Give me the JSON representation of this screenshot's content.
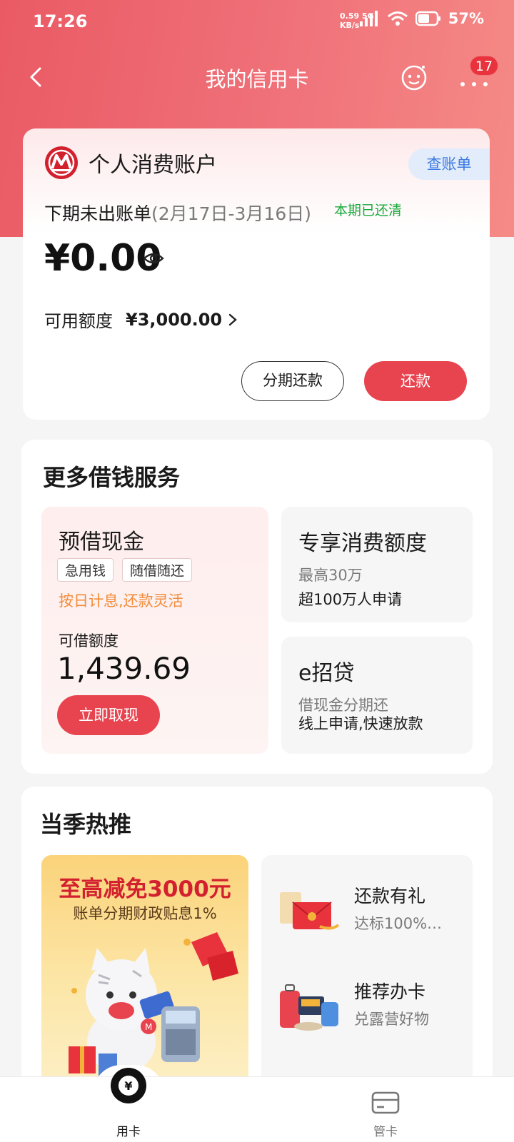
{
  "status_bar": {
    "time": "17:26",
    "net_speed_value": "0.59",
    "net_speed_unit": "KB/s",
    "signal_label": "5G",
    "battery": "57%"
  },
  "nav": {
    "title": "我的信用卡",
    "badge_count": "17",
    "icons": {
      "back": "back-arrow-icon",
      "assistant": "robot-assistant-icon",
      "more": "more-dots-icon"
    }
  },
  "account": {
    "name": "个人消费账户",
    "bill_button": "查账单",
    "next_bill_label": "下期未出账单",
    "next_bill_period": "(2月17日-3月16日)",
    "status": "本期已还清",
    "amount": "¥0.00",
    "available_label": "可用额度",
    "available_value": "¥3,000.00",
    "installment_button": "分期还款",
    "repay_button": "还款"
  },
  "loan_services": {
    "title": "更多借钱服务",
    "cash": {
      "title": "预借现金",
      "tags": [
        "急用钱",
        "随借随还"
      ],
      "note": "按日计息,还款灵活",
      "limit_label": "可借额度",
      "limit_value": "1,439.69",
      "button": "立即取现"
    },
    "consumer": {
      "title": "专享消费额度",
      "line1": "最高30万",
      "line2": "超100万人申请"
    },
    "eloan": {
      "title": "e招贷",
      "line1": "借现金分期还",
      "line2": "线上申请,快速放款"
    }
  },
  "hot": {
    "title": "当季热推",
    "promo": {
      "headline": "至高减免3000元",
      "subline": "账单分期财政贴息1%"
    },
    "items": [
      {
        "name": "还款有礼",
        "desc": "达标100%…"
      },
      {
        "name": "推荐办卡",
        "desc": "兑露营好物"
      }
    ]
  },
  "tabbar": {
    "tabs": [
      {
        "label": "用卡",
        "icon": "yen-coin-icon",
        "active": true
      },
      {
        "label": "管卡",
        "icon": "card-icon",
        "active": false
      }
    ]
  },
  "colors": {
    "brand_red": "#e8444f",
    "paid_green": "#1aaa3c",
    "link_blue": "#3d7be2",
    "note_orange": "#f28b3a"
  }
}
